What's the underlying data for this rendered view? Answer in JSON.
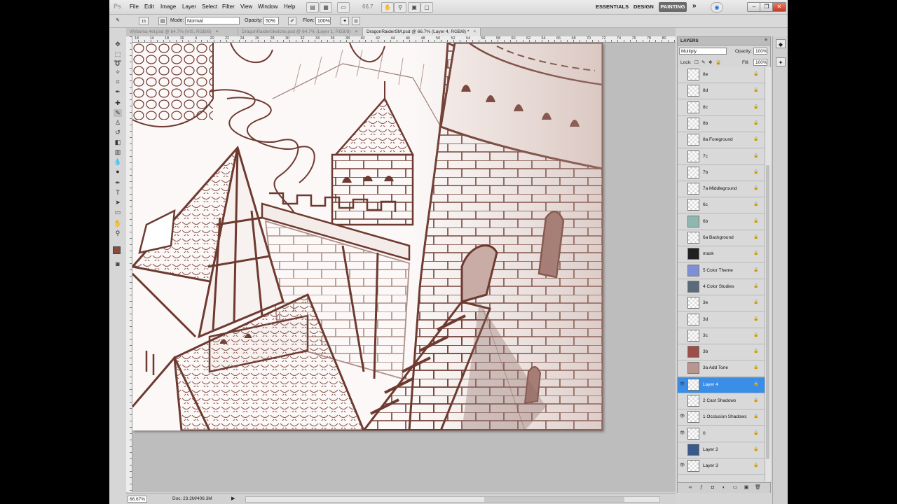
{
  "menubar": {
    "logo": "Ps",
    "items": [
      "File",
      "Edit",
      "Image",
      "Layer",
      "Select",
      "Filter",
      "View",
      "Window",
      "Help"
    ],
    "zoom": "66.7",
    "workspaces": [
      "ESSENTIALS",
      "DESIGN"
    ],
    "active_workspace": "PAINTING",
    "more": "»"
  },
  "options": {
    "mode_label": "Mode:",
    "mode_value": "Normal",
    "opacity_label": "Opacity:",
    "opacity_value": "50%",
    "flow_label": "Flow:",
    "flow_value": "100%",
    "brush_size": "15"
  },
  "tabs": [
    {
      "label": "Wyboma 4el.psd @ 64.7% (VIS, RGB/8)",
      "active": false
    },
    {
      "label": "DragonRaiderSketchs.psd @ 64.7% (Layer 1, RGB/8)",
      "active": false
    },
    {
      "label": "DragonRaiderSM.psd @ 66.7% (Layer 4, RGB/8) *",
      "active": true
    }
  ],
  "ruler": {
    "h_numbers": [
      "18",
      "14",
      "18",
      "16",
      "4",
      "20",
      "22",
      "24",
      "26",
      "28",
      "30",
      "32",
      "34",
      "36",
      "38",
      "40",
      "42",
      "44",
      "46",
      "48",
      "50",
      "52",
      "54",
      "56",
      "58",
      "60",
      "62",
      "64",
      "66",
      "68",
      "70",
      "72",
      "74",
      "76",
      "78",
      "80"
    ]
  },
  "status": {
    "zoom": "66.67%",
    "doc": "Doc: 23.2M/406.3M"
  },
  "layers_panel": {
    "title": "LAYERS",
    "blend_mode": "Multiply",
    "opacity_label": "Opacity:",
    "opacity_value": "100%",
    "lock_label": "Lock:",
    "fill_label": "Fill:",
    "fill_value": "100%",
    "layers": [
      {
        "name": "8e",
        "visible": false,
        "selected": false,
        "thumb": "blank"
      },
      {
        "name": "8d",
        "visible": false,
        "selected": false,
        "thumb": "blank"
      },
      {
        "name": "8c",
        "visible": false,
        "selected": false,
        "thumb": "blank"
      },
      {
        "name": "8b",
        "visible": false,
        "selected": false,
        "thumb": "blank"
      },
      {
        "name": "8a Foreground",
        "visible": false,
        "selected": false,
        "thumb": "blank"
      },
      {
        "name": "7c",
        "visible": false,
        "selected": false,
        "thumb": "blank"
      },
      {
        "name": "7b",
        "visible": false,
        "selected": false,
        "thumb": "blank"
      },
      {
        "name": "7a Middleground",
        "visible": false,
        "selected": false,
        "thumb": "blank"
      },
      {
        "name": "6c",
        "visible": false,
        "selected": false,
        "thumb": "blank"
      },
      {
        "name": "6b",
        "visible": false,
        "selected": false,
        "thumb": "teal"
      },
      {
        "name": "6a Background",
        "visible": false,
        "selected": false,
        "thumb": "blank"
      },
      {
        "name": "mask",
        "visible": false,
        "selected": false,
        "thumb": "dark"
      },
      {
        "name": "5 Color Theme",
        "visible": false,
        "selected": false,
        "thumb": "blue"
      },
      {
        "name": "4 Color Studies",
        "visible": false,
        "selected": false,
        "thumb": "grid"
      },
      {
        "name": "3e",
        "visible": false,
        "selected": false,
        "thumb": "blank"
      },
      {
        "name": "3d",
        "visible": false,
        "selected": false,
        "thumb": "blank"
      },
      {
        "name": "3c",
        "visible": false,
        "selected": false,
        "thumb": "blank"
      },
      {
        "name": "3b",
        "visible": false,
        "selected": false,
        "thumb": "red"
      },
      {
        "name": "3a Add Tone",
        "visible": false,
        "selected": false,
        "thumb": "tone"
      },
      {
        "name": "Layer 4",
        "visible": true,
        "selected": true,
        "thumb": "blank"
      },
      {
        "name": "2 Cast Shadows",
        "visible": false,
        "selected": false,
        "thumb": "blank"
      },
      {
        "name": "1 Occlusion Shadows",
        "visible": true,
        "selected": false,
        "thumb": "blank"
      },
      {
        "name": "0",
        "visible": true,
        "selected": false,
        "thumb": "blank"
      },
      {
        "name": "Layer 2",
        "visible": false,
        "selected": false,
        "thumb": "photo"
      },
      {
        "name": "Layer 3",
        "visible": true,
        "selected": false,
        "thumb": "blank"
      }
    ]
  },
  "colors": {
    "selection": "#3a8ee6",
    "sketch_line": "#6e3a30",
    "foreground_swatch": "#8b4a3a"
  }
}
